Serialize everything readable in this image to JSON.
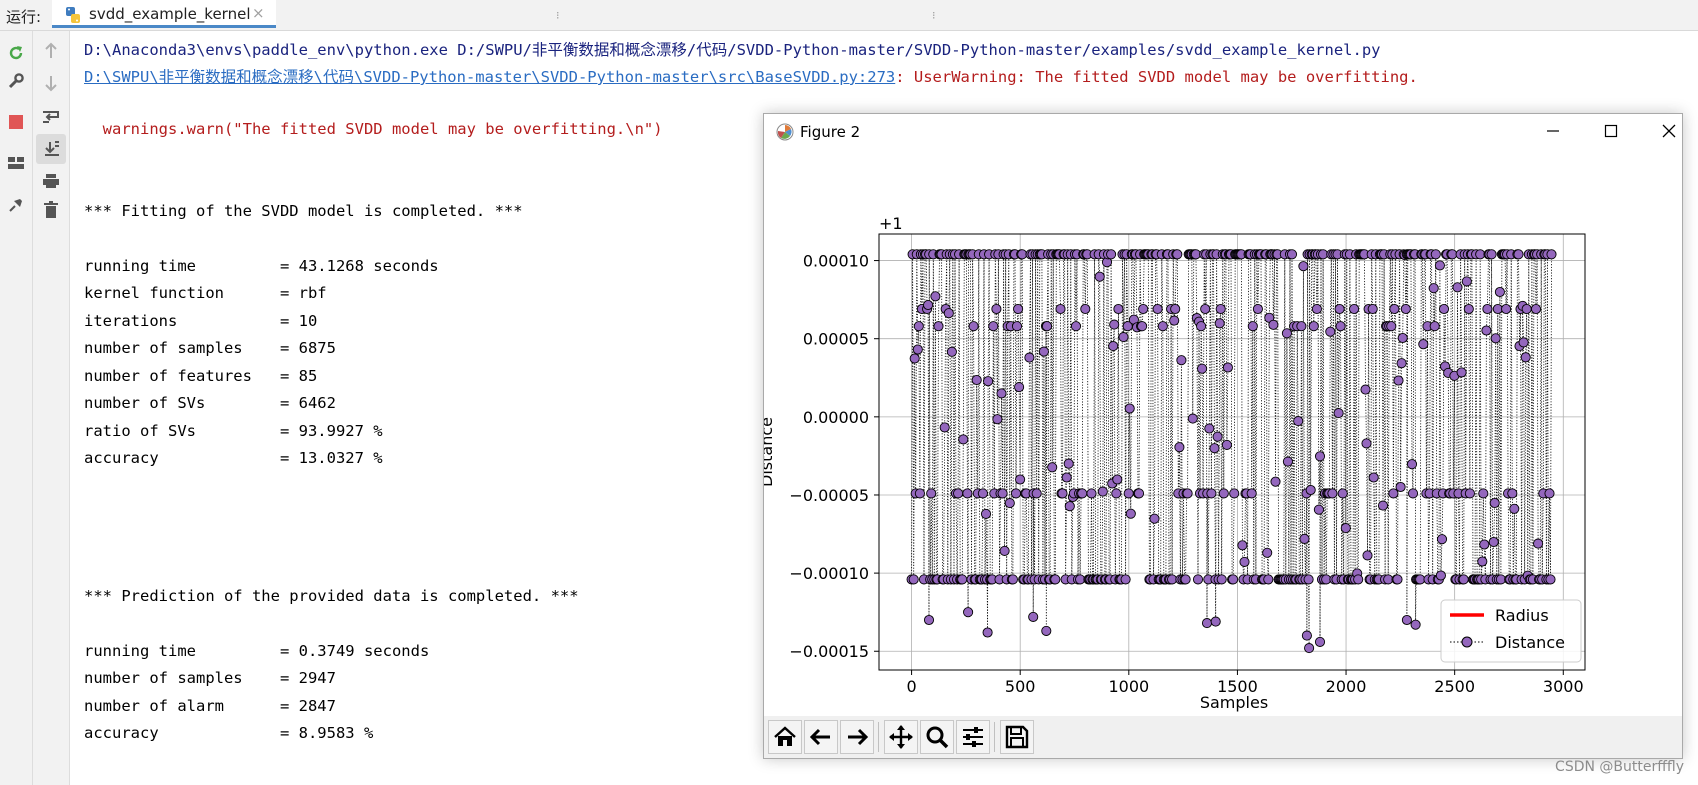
{
  "run_bar": {
    "label": "运行:",
    "tab_name": "svdd_example_kernel",
    "close_glyph": "×"
  },
  "left_tools": [
    "rerun-icon",
    "wrench-icon",
    "stop-icon",
    "layout-icon",
    "pin-icon"
  ],
  "side_tools": [
    "up-arrow-icon",
    "down-arrow-icon",
    "soft-wrap-icon",
    "scroll-to-end-icon",
    "print-icon",
    "trash-icon"
  ],
  "console": {
    "command": "D:\\Anaconda3\\envs\\paddle_env\\python.exe D:/SWPU/非平衡数据和概念漂移/代码/SVDD-Python-master/SVDD-Python-master/examples/svdd_example_kernel.py",
    "warning_link": "D:\\SWPU\\非平衡数据和概念漂移\\代码\\SVDD-Python-master\\SVDD-Python-master\\src\\BaseSVDD.py:273",
    "warning_text": ": UserWarning: The fitted SVDD model may be overfitting.",
    "warn_call": "  warnings.warn(\"The fitted SVDD model may be overfitting.\\n\")",
    "fit_header": "*** Fitting of the SVDD model is completed. ***",
    "fit_stats": [
      "running time         = 43.1268 seconds",
      "kernel function      = rbf",
      "iterations           = 10",
      "number of samples    = 6875",
      "number of features   = 85",
      "number of SVs        = 6462",
      "ratio of SVs         = 93.9927 %",
      "accuracy             = 13.0327 %"
    ],
    "pred_header": "*** Prediction of the provided data is completed. ***",
    "pred_stats": [
      "running time         = 0.3749 seconds",
      "number of samples    = 2947",
      "number of alarm      = 2847",
      "accuracy             = 8.9583 %"
    ]
  },
  "figure_window": {
    "title": "Figure 2",
    "buttons": [
      "minimize-icon",
      "maximize-icon",
      "close-icon"
    ],
    "toolbar": [
      "home-icon",
      "back-icon",
      "forward-icon",
      "pan-icon",
      "zoom-icon",
      "configure-icon",
      "save-icon"
    ]
  },
  "chart_data": {
    "type": "line",
    "title": "",
    "xlabel": "Samples",
    "ylabel": "Distance",
    "offset_label": "+1",
    "xlim": [
      -150,
      3100
    ],
    "ylim": [
      -0.000162,
      0.000117
    ],
    "x_ticks": [
      0,
      500,
      1000,
      1500,
      2000,
      2500,
      3000
    ],
    "y_ticks": [
      0.0001,
      5e-05,
      0.0,
      -5e-05,
      -0.0001,
      -0.00015
    ],
    "y_tick_labels": [
      "0.00010",
      "0.00005",
      "0.00000",
      "−0.00005",
      "−0.00010",
      "−0.00015"
    ],
    "grid": true,
    "legend_position": "lower right",
    "series": [
      {
        "name": "Radius",
        "style": "solid red line",
        "color": "#ff0000",
        "note_value": 1.0
      },
      {
        "name": "Distance",
        "style": "dotted black line with purple circle markers",
        "color": "#9467bd",
        "n_points": 2947,
        "levels": [
          0.000104,
          6.9e-05,
          5.8e-05,
          -4.9e-05,
          -0.000104
        ],
        "low_outliers": [
          {
            "x": 80,
            "y": -0.00013
          },
          {
            "x": 260,
            "y": -0.000125
          },
          {
            "x": 350,
            "y": -0.000138
          },
          {
            "x": 560,
            "y": -0.000128
          },
          {
            "x": 620,
            "y": -0.000137
          },
          {
            "x": 1360,
            "y": -0.000132
          },
          {
            "x": 1400,
            "y": -0.000131
          },
          {
            "x": 1820,
            "y": -0.00014
          },
          {
            "x": 1830,
            "y": -0.000148
          },
          {
            "x": 1880,
            "y": -0.000144
          },
          {
            "x": 2280,
            "y": -0.00013
          },
          {
            "x": 2320,
            "y": -0.000133
          }
        ]
      }
    ]
  },
  "watermark": "CSDN @Butterfffly"
}
